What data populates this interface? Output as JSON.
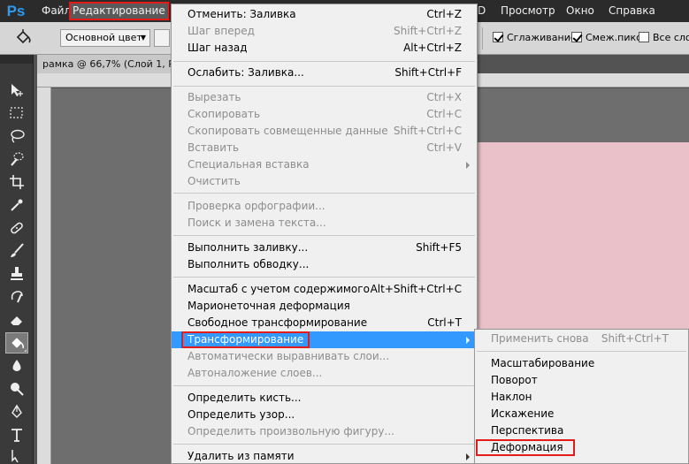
{
  "app": {
    "logo": "Ps"
  },
  "menubar": {
    "items": [
      "Файл",
      "Редактирование",
      "D",
      "Просмотр",
      "Окно",
      "Справка"
    ],
    "active_index": 1
  },
  "options": {
    "mode_dropdown": "Основной цвет",
    "checkbox_antialias": "Сглаживание",
    "checkbox_contiguous": "Смеж.пикс",
    "checkbox_all_layers": "Все сло"
  },
  "document": {
    "tab_title": "рамка @ 66,7% (Слой 1, RG"
  },
  "tools": [
    "move-icon",
    "marquee-icon",
    "lasso-icon",
    "quick-select-icon",
    "crop-icon",
    "eyedropper-icon",
    "healing-icon",
    "brush-icon",
    "stamp-icon",
    "history-brush-icon",
    "eraser-icon",
    "paint-bucket-icon",
    "blur-icon",
    "dodge-icon",
    "pen-icon",
    "type-icon",
    "path-select-icon"
  ],
  "edit_menu": {
    "items": [
      {
        "label": "Отменить: Заливка",
        "shortcut": "Ctrl+Z"
      },
      {
        "label": "Шаг вперед",
        "shortcut": "Shift+Ctrl+Z"
      },
      {
        "label": "Шаг назад",
        "shortcut": "Alt+Ctrl+Z"
      },
      {
        "label": "Ослабить: Заливка...",
        "shortcut": "Shift+Ctrl+F"
      },
      {
        "label": "Вырезать",
        "shortcut": "Ctrl+X"
      },
      {
        "label": "Скопировать",
        "shortcut": "Ctrl+C"
      },
      {
        "label": "Скопировать совмещенные данные",
        "shortcut": "Shift+Ctrl+C"
      },
      {
        "label": "Вставить",
        "shortcut": "Ctrl+V"
      },
      {
        "label": "Специальная вставка",
        "shortcut": ""
      },
      {
        "label": "Очистить",
        "shortcut": ""
      },
      {
        "label": "Проверка орфографии...",
        "shortcut": ""
      },
      {
        "label": "Поиск и замена текста...",
        "shortcut": ""
      },
      {
        "label": "Выполнить заливку...",
        "shortcut": "Shift+F5"
      },
      {
        "label": "Выполнить обводку...",
        "shortcut": ""
      },
      {
        "label": "Масштаб с учетом содержимого",
        "shortcut": "Alt+Shift+Ctrl+C"
      },
      {
        "label": "Марионеточная деформация",
        "shortcut": ""
      },
      {
        "label": "Свободное трансформирование",
        "shortcut": "Ctrl+T"
      },
      {
        "label": "Трансформирование",
        "shortcut": ""
      },
      {
        "label": "Автоматически выравнивать слои...",
        "shortcut": ""
      },
      {
        "label": "Автоналожение слоев...",
        "shortcut": ""
      },
      {
        "label": "Определить кисть...",
        "shortcut": ""
      },
      {
        "label": "Определить узор...",
        "shortcut": ""
      },
      {
        "label": "Определить произвольную фигуру...",
        "shortcut": ""
      },
      {
        "label": "Удалить из памяти",
        "shortcut": ""
      }
    ]
  },
  "transform_submenu": {
    "items": [
      {
        "label": "Применить снова",
        "shortcut": "Shift+Ctrl+T"
      },
      {
        "label": "Масштабирование",
        "shortcut": ""
      },
      {
        "label": "Поворот",
        "shortcut": ""
      },
      {
        "label": "Наклон",
        "shortcut": ""
      },
      {
        "label": "Искажение",
        "shortcut": ""
      },
      {
        "label": "Перспектива",
        "shortcut": ""
      },
      {
        "label": "Деформация",
        "shortcut": ""
      }
    ]
  },
  "colors": {
    "menu_highlight": "#3399ff",
    "callout_red": "#e41b1b",
    "canvas_pink": "#eac1c8",
    "disabled_text": "#8d8d8d"
  }
}
